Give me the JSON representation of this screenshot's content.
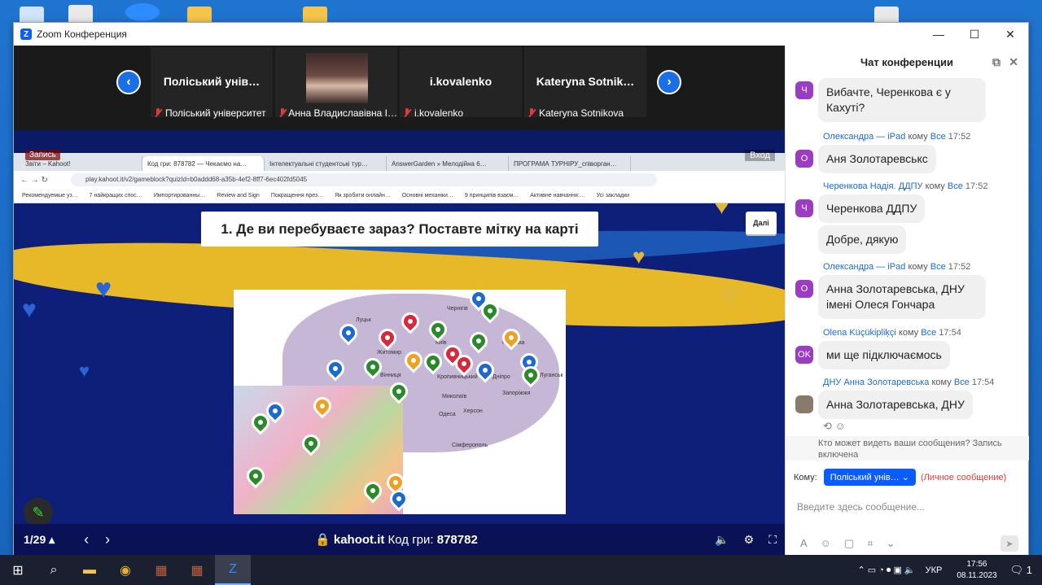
{
  "window": {
    "title": "Zoom Конференция"
  },
  "participants": [
    {
      "name": "Поліський унів…",
      "label": "Поліський університет"
    },
    {
      "name": "",
      "label": "Анна Владиславівна І…"
    },
    {
      "name": "i.kovalenko",
      "label": "i.kovalenko"
    },
    {
      "name": "Kateryna  Sotnik…",
      "label": "Kateryna Sotnikova"
    }
  ],
  "share": {
    "recording_label": "Запись",
    "enter_label": "Вход",
    "tabs": [
      "Звіти – Kahoot!",
      "Код гри: 878782 — Чекаємо на…",
      "Інтелектуальні студентські тур…",
      "AnswerGarden » Мелодійна 6…",
      "ПРОГРАМА ТУРНІРУ_співорган…"
    ],
    "url": "play.kahoot.it/v2/gameblock?quizId=b0addd68-a35b-4ef2-8ff7-6ec402fd5045",
    "bookmarks": [
      "Рекомендуемые уз…",
      "7 найкращих спос…",
      "Импортированны…",
      "Review and Sign",
      "Покращення през…",
      "Як зробити онлайн…",
      "Основні механіки…",
      "9 принципів взаєм…",
      "Активне навчання:…",
      "Усі закладки"
    ],
    "question": "1. Де ви перебуваєте зараз? Поставте мітку на карті",
    "next_label": "Далі",
    "counter": "1/29 ▴",
    "site": "kahoot.it",
    "game_pin_label": "Код гри:",
    "game_pin": "878782"
  },
  "map_labels": [
    "Чернігів",
    "Луцьк",
    "Київ",
    "Житомир",
    "Полтава",
    "Вінниця",
    "Кропивницький",
    "Дніпро",
    "Луганськ",
    "Запоріжжя",
    "Херсон",
    "Миколаїв",
    "Одеса",
    "Сімферополь"
  ],
  "chat": {
    "title": "Чат конференции",
    "messages": [
      {
        "avatar": "Ч",
        "sender": "",
        "to": "",
        "recipient": "",
        "time": "",
        "text": "Вибачте, Черенкова є у Кахуті?"
      },
      {
        "avatar": "О",
        "sender": "Олександра — iPad",
        "to": "кому",
        "recipient": "Все",
        "time": "17:52",
        "text": "Аня Золотаревськс"
      },
      {
        "avatar": "Ч",
        "sender": "Черенкова Надія. ДДПУ",
        "to": "кому",
        "recipient": "Все",
        "time": "17:52",
        "text": "Черенкова ДДПУ"
      },
      {
        "avatar": "",
        "sender": "",
        "to": "",
        "recipient": "",
        "time": "",
        "text": "Добре, дякую"
      },
      {
        "avatar": "О",
        "sender": "Олександра — iPad",
        "to": "кому",
        "recipient": "Все",
        "time": "17:52",
        "text": "Анна Золотаревська, ДНУ імені Олеся Гончара"
      },
      {
        "avatar": "OK",
        "sender": "Olena Küçükipliķçi",
        "to": "кому",
        "recipient": "Все",
        "time": "17:54",
        "text": "ми ще підключаємось"
      },
      {
        "avatar": "",
        "sender": "ДНУ Анна Золотаревська",
        "to": "кому",
        "recipient": "Все",
        "time": "17:54",
        "text": "Анна Золотаревська, ДНУ"
      }
    ],
    "notice": "Кто может видеть ваши сообщения? Запись включена",
    "to_label": "Кому:",
    "to_value": "Поліський унів…",
    "private_label": "(Личное сообщение)",
    "input_placeholder": "Введите здесь сообщение..."
  },
  "taskbar": {
    "lang": "УКР",
    "time": "17:56",
    "date": "08.11.2023",
    "notifications": "1"
  }
}
